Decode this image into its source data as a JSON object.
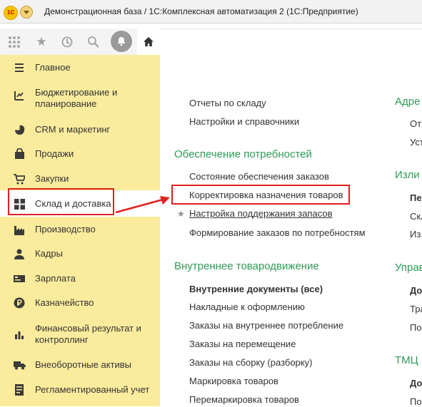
{
  "window": {
    "logo_text": "1С",
    "title": "Демонстрационная база / 1С:Комплексная автоматизация 2 (1С:Предприятие)"
  },
  "toolbar": {
    "apps_icon": "apps-grid-icon",
    "favorites_icon": "star-icon",
    "history_icon": "history-icon",
    "search_icon": "search-icon",
    "notifications_icon": "bell-icon",
    "home_icon": "home-icon"
  },
  "sidebar": {
    "items": [
      {
        "label": "Главное",
        "icon": "menu-lines-icon"
      },
      {
        "label": "Бюджетирование и\nпланирование",
        "icon": "budget-chart-icon"
      },
      {
        "label": "CRM и маркетинг",
        "icon": "pie-chart-icon"
      },
      {
        "label": "Продажи",
        "icon": "bag-icon"
      },
      {
        "label": "Закупки",
        "icon": "cart-icon"
      },
      {
        "label": "Склад и доставка",
        "icon": "warehouse-icon"
      },
      {
        "label": "Производство",
        "icon": "factory-icon"
      },
      {
        "label": "Кадры",
        "icon": "person-icon"
      },
      {
        "label": "Зарплата",
        "icon": "payroll-icon"
      },
      {
        "label": "Казначейство",
        "icon": "ruble-coin-icon"
      },
      {
        "label": "Финансовый результат и\nконтроллинг",
        "icon": "bar-chart-icon"
      },
      {
        "label": "Внеоборотные активы",
        "icon": "truck-icon"
      },
      {
        "label": "Регламентированный учет",
        "icon": "ledger-icon"
      }
    ]
  },
  "content": {
    "col1": {
      "top_links": [
        "Отчеты по складу",
        "Настройки и справочники"
      ],
      "section1": {
        "title": "Обеспечение потребностей",
        "items": [
          "Состояние обеспечения заказов",
          "Корректировка назначения товаров",
          "Настройка поддержания запасов",
          "Формирование заказов по потребностям"
        ]
      },
      "section2": {
        "title": "Внутреннее товародвижение",
        "items": [
          "Внутренние документы (все)",
          "Накладные к оформлению",
          "Заказы на внутреннее потребление",
          "Заказы на перемещение",
          "Заказы на сборку (разборку)",
          "Маркировка товаров",
          "Перемаркировка товаров"
        ]
      }
    },
    "col2": {
      "headings": [
        "Адре",
        "Изли",
        "Управ",
        "ТМЦ"
      ],
      "items": [
        "Отч",
        "Уст",
        "Пе",
        "Скл",
        "Из.",
        "До",
        "Тра",
        "По",
        "До",
        "По"
      ]
    }
  },
  "annotation": {
    "color": "#e02020"
  }
}
